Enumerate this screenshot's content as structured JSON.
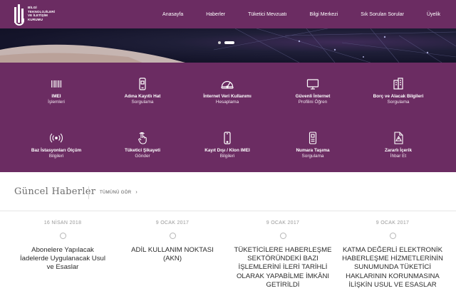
{
  "logo": {
    "lines": [
      "BİLGİ",
      "TEKNOLOJİLERİ",
      "VE İLETİŞİM",
      "KURUMU"
    ]
  },
  "nav": {
    "items": [
      "Anasayfa",
      "Haberler",
      "Tüketici Mevzuatı",
      "Bilgi Merkezi",
      "Sık Sorulan Sorular",
      "Üyelik"
    ]
  },
  "banner": {
    "slide_count": 2,
    "active_slide": 2
  },
  "services": [
    {
      "title": "IMEI",
      "subtitle": "İşlemleri",
      "icon": "barcode-icon"
    },
    {
      "title": "Adına Kayıtlı Hat",
      "subtitle": "Sorgulama",
      "icon": "phone-sim-icon"
    },
    {
      "title": "İnternet Veri Kullanımı",
      "subtitle": "Hesaplama",
      "icon": "speedometer-icon"
    },
    {
      "title": "Güvenli İnternet",
      "subtitle": "Profilini Öğren",
      "icon": "monitor-icon"
    },
    {
      "title": "Borç ve Alacak Bilgileri",
      "subtitle": "Sorgulama",
      "icon": "building-icon"
    },
    {
      "title": "Baz İstasyonları Ölçüm",
      "subtitle": "Bilgileri",
      "icon": "signal-tower-icon"
    },
    {
      "title": "Tüketici Şikayeti",
      "subtitle": "Gönder",
      "icon": "hand-touch-icon"
    },
    {
      "title": "Kayıt Dışı / Klon IMEI",
      "subtitle": "Bilgileri",
      "icon": "mobile-phone-icon"
    },
    {
      "title": "Numara Taşıma",
      "subtitle": "Sorgulama",
      "icon": "number-transfer-icon"
    },
    {
      "title": "Zararlı İçerik",
      "subtitle": "İhbar Et",
      "icon": "document-warning-icon"
    }
  ],
  "news": {
    "section_title": "Güncel Haberler",
    "all_link": "TÜMÜNÜ GÖR",
    "arrow": "›",
    "items": [
      {
        "date": "16 NİSAN 2018",
        "headline": "Abonelere Yapılacak İadelerde Uygulanacak Usul ve Esaslar"
      },
      {
        "date": "9 OCAK 2017",
        "headline": "ADİL KULLANIM NOKTASI (AKN)"
      },
      {
        "date": "9 OCAK 2017",
        "headline": "TÜKETİCİLERE HABERLEŞME SEKTÖRÜNDEKİ BAZI İŞLEMLERİNİ İLERİ TARİHLİ OLARAK YAPABİLME İMKÂNI GETİRİLDİ"
      },
      {
        "date": "9 OCAK 2017",
        "headline": "KATMA DEĞERLİ ELEKTRONİK HABERLEŞME HİZMETLERİNİN SUNUMUNDA TÜKETİCİ HAKLARININ KORUNMASINA İLİŞKİN USUL VE ESASLAR"
      }
    ]
  },
  "colors": {
    "brand_purple": "#6b2c62",
    "banner_dark": "#14142a"
  }
}
